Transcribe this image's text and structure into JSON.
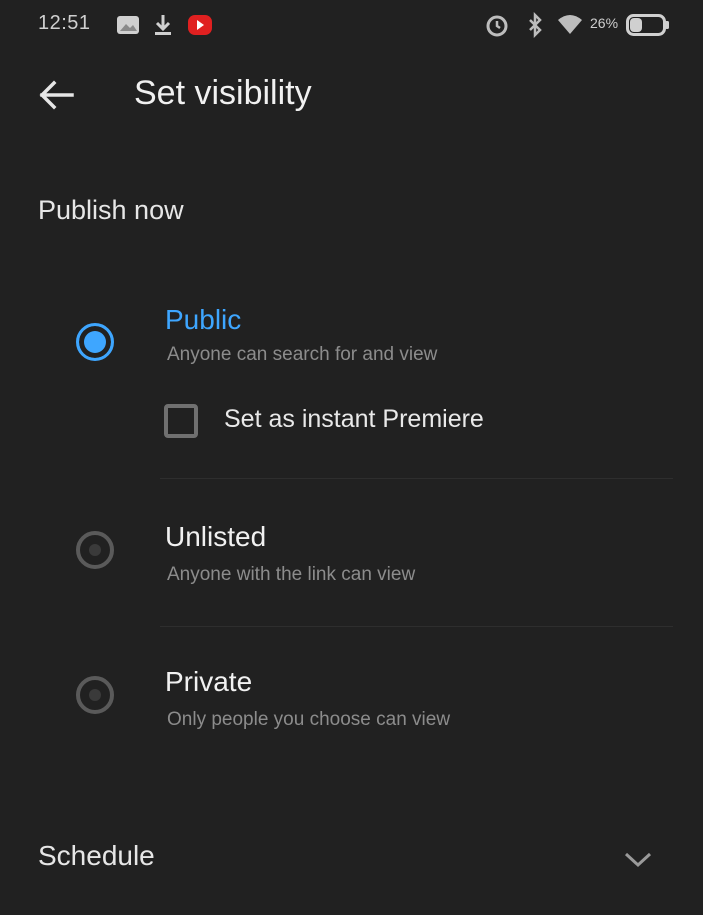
{
  "status_bar": {
    "time": "12:51",
    "battery_text": "26%",
    "icons": [
      "gallery-icon",
      "download-icon",
      "youtube-notification-icon",
      "alarm-icon",
      "bluetooth-icon",
      "wifi-icon",
      "battery-icon"
    ]
  },
  "header": {
    "back_icon": "arrow-left-icon",
    "title": "Set visibility"
  },
  "section": {
    "heading": "Publish now"
  },
  "options": [
    {
      "title": "Public",
      "description": "Anyone can search for and view",
      "selected": true
    },
    {
      "title": "Unlisted",
      "description": "Anyone with the link can view",
      "selected": false
    },
    {
      "title": "Private",
      "description": "Only people you choose can view",
      "selected": false
    }
  ],
  "premiere": {
    "label": "Set as instant Premiere",
    "checked": false
  },
  "schedule": {
    "label": "Schedule",
    "icon": "chevron-down-icon"
  },
  "colors": {
    "background": "#212121",
    "accent": "#3ea6ff",
    "text_primary": "#f1f1f1",
    "text_secondary": "#8c8c8c",
    "notification_red": "#e02020"
  }
}
